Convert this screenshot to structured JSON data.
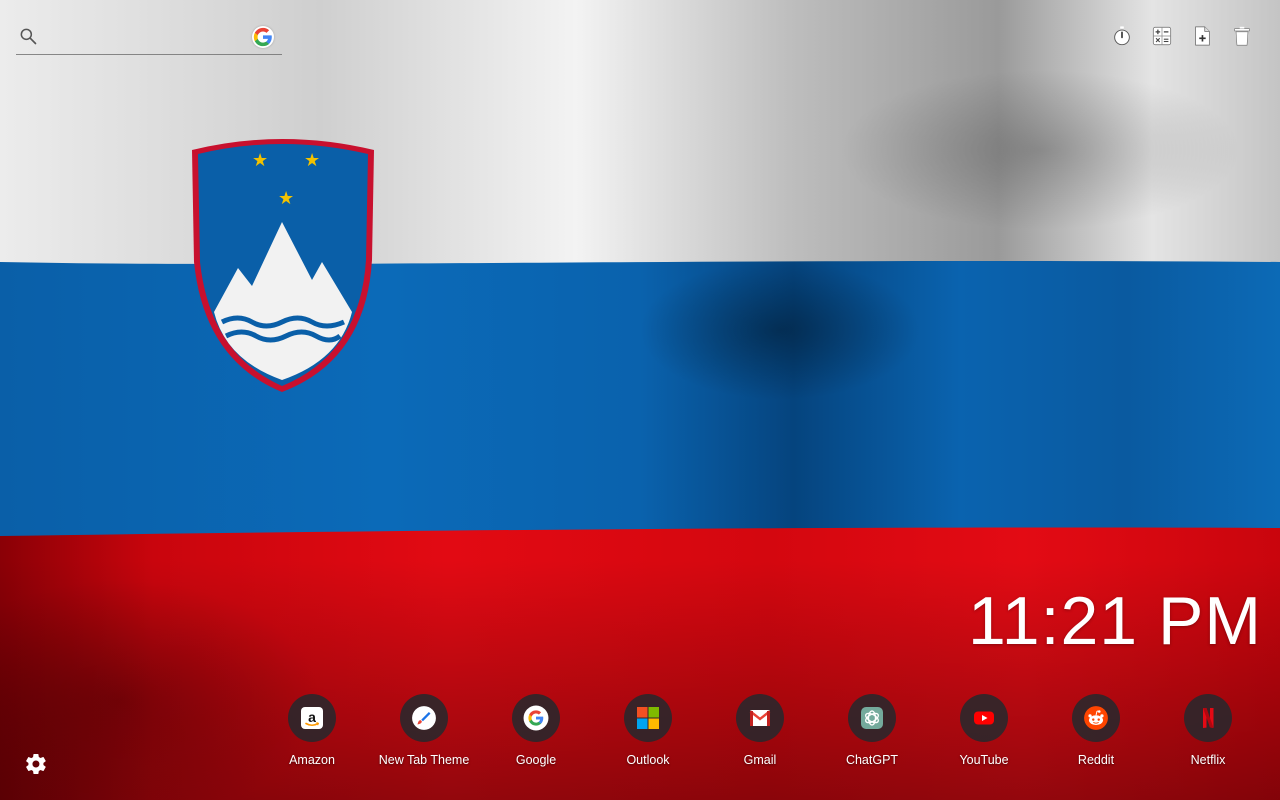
{
  "search": {
    "value": "",
    "placeholder": "",
    "engine_icon": "google-icon"
  },
  "toolbar": [
    {
      "icon": "timer-icon"
    },
    {
      "icon": "calculator-icon"
    },
    {
      "icon": "add-note-icon"
    },
    {
      "icon": "trash-icon"
    }
  ],
  "clock": {
    "time": "11:21 PM"
  },
  "shortcuts": [
    {
      "label": "Amazon",
      "icon": "amazon-icon"
    },
    {
      "label": "New Tab Theme",
      "icon": "paint-brush-icon"
    },
    {
      "label": "Google",
      "icon": "google-icon"
    },
    {
      "label": "Outlook",
      "icon": "microsoft-icon"
    },
    {
      "label": "Gmail",
      "icon": "gmail-icon"
    },
    {
      "label": "ChatGPT",
      "icon": "chatgpt-icon"
    },
    {
      "label": "YouTube",
      "icon": "youtube-icon"
    },
    {
      "label": "Reddit",
      "icon": "reddit-icon"
    },
    {
      "label": "Netflix",
      "icon": "netflix-icon"
    }
  ],
  "settings": {
    "icon": "gear-icon"
  },
  "colors": {
    "flag_white": "#e8e8e8",
    "flag_blue": "#0a5fa8",
    "flag_red": "#d60a12",
    "clock_text": "#ffffff"
  }
}
